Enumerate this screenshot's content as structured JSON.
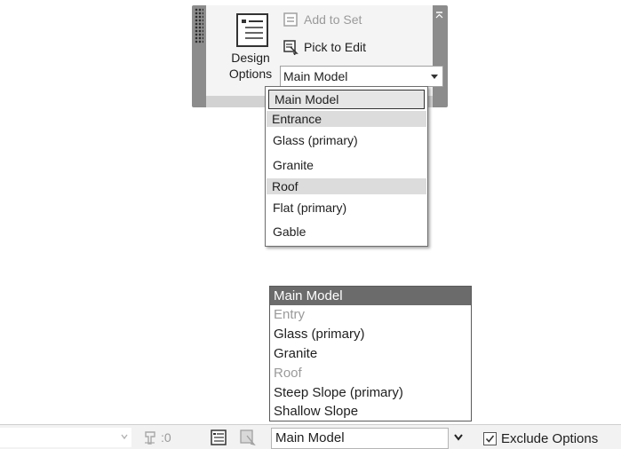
{
  "ribbon_panel": {
    "design_options_label": [
      "Design",
      "Options"
    ],
    "add_to_set_label": "Add to Set",
    "pick_to_edit_label": "Pick to Edit",
    "current_option": "Main Model",
    "dropdown": {
      "selected": "Main Model",
      "groups": [
        {
          "header": "Entrance",
          "options": [
            "Glass (primary)",
            "Granite"
          ]
        },
        {
          "header": "Roof",
          "options": [
            "Flat (primary)",
            "Gable"
          ]
        }
      ]
    }
  },
  "status_bar": {
    "editable_count": ":0",
    "current_option": "Main Model",
    "exclude_options_label": "Exclude Options",
    "exclude_options_checked": true,
    "dropdown": {
      "items": [
        {
          "label": "Main Model",
          "state": "selected"
        },
        {
          "label": "Entry",
          "state": "disabled"
        },
        {
          "label": "Glass (primary)",
          "state": "enabled"
        },
        {
          "label": "Granite",
          "state": "enabled"
        },
        {
          "label": "Roof",
          "state": "disabled"
        },
        {
          "label": "Steep Slope (primary)",
          "state": "enabled"
        },
        {
          "label": "Shallow Slope",
          "state": "enabled"
        }
      ]
    }
  },
  "colors": {
    "panel_frame": "#8c8c8c",
    "selected_highlight": "#6b6b6b",
    "disabled_text": "#9a9a9a"
  }
}
